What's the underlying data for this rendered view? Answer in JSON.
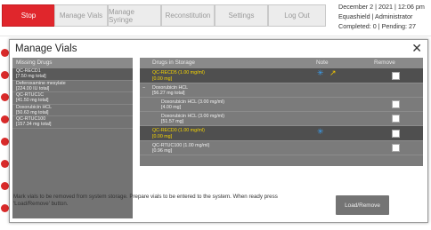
{
  "toolbar": {
    "stop_label": "Stop",
    "manage_vials_label": "Manage Vials",
    "manage_syringe_label": "Manage Syringe",
    "reconstitution_label": "Reconstitution",
    "settings_label": "Settings",
    "logout_label": "Log Out"
  },
  "status": {
    "datetime": "December 2 | 2021 | 12:06 pm",
    "user": "Equashield | Administrator",
    "counts": "Completed: 0 | Pending: 27"
  },
  "modal": {
    "title": "Manage Vials",
    "close_glyph": "✕",
    "missing_header": "Missing Drugs",
    "missing_drugs": [
      {
        "name": "QC-RECD1",
        "amount": "[7.50 mg total]"
      },
      {
        "name": "Deferoxamine mesylate",
        "amount": "[224.00 IU total]"
      },
      {
        "name": "QC-RTUC1C",
        "amount": "[41.50 mg total]"
      },
      {
        "name": "Doxorubicin HCL",
        "amount": "[50.63 mg total]"
      },
      {
        "name": "QC-RTUC100",
        "amount": "[157.34 mg total]"
      }
    ],
    "storage_header": "Drugs in Storage",
    "note_header": "Note",
    "remove_header": "Remove",
    "storage_rows": [
      {
        "line1": "QC-RECD5 (1.00 mg/ml)",
        "line2": "[0.00 mg]"
      },
      {
        "line1": "Doxorubicin HCL",
        "line2": "[56.27 mg total]",
        "group_glyph": "−"
      },
      {
        "line1": "Doxorubicin HCL (3.00 mg/ml)",
        "line2": "[4.00 mg]"
      },
      {
        "line1": "Doxorubicin HCL (3.00 mg/ml)",
        "line2": "[51.57 mg]"
      },
      {
        "line1": "QC-RECD0 (1.00 mg/ml)",
        "line2": "[0.00 mg]"
      },
      {
        "line1": "QC-RTUC100 (1.00 mg/ml)",
        "line2": "[0.96 mg]"
      }
    ],
    "instructions": "Mark vials to be removed from system storage. Prepare vials to be entered to the system. When ready press 'Load/Remove' button.",
    "load_remove_label": "Load/Remove"
  },
  "colors": {
    "stop": "#e0262c",
    "panel": "#7b7b7b",
    "highlight_text": "#f5d400",
    "note_icon": "#3aa0f2"
  },
  "icons": {
    "note": "snowflake-icon",
    "edit": "pencil-arrow-icon",
    "close": "close-icon"
  }
}
